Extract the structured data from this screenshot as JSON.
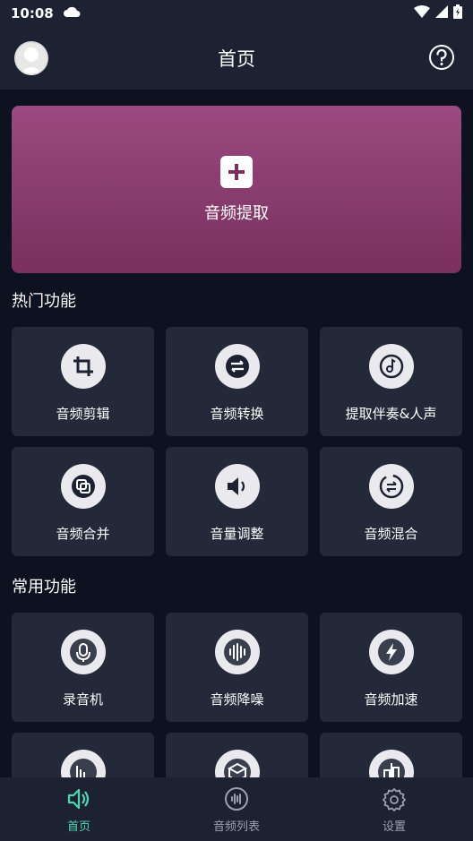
{
  "status": {
    "time": "10:08"
  },
  "header": {
    "title": "首页"
  },
  "hero": {
    "label": "音频提取"
  },
  "hot": {
    "title": "热门功能",
    "items": [
      {
        "label": "音频剪辑",
        "icon": "crop-icon"
      },
      {
        "label": "音频转换",
        "icon": "convert-icon"
      },
      {
        "label": "提取伴奏&人声",
        "icon": "music-note-icon"
      },
      {
        "label": "音频合并",
        "icon": "merge-icon"
      },
      {
        "label": "音量调整",
        "icon": "volume-icon"
      },
      {
        "label": "音频混合",
        "icon": "mix-icon"
      }
    ]
  },
  "common": {
    "title": "常用功能",
    "items": [
      {
        "label": "录音机",
        "icon": "mic-icon"
      },
      {
        "label": "音频降噪",
        "icon": "waveform-icon"
      },
      {
        "label": "音频加速",
        "icon": "lightning-icon"
      }
    ]
  },
  "nav": {
    "items": [
      {
        "label": "首页"
      },
      {
        "label": "音频列表"
      },
      {
        "label": "设置"
      }
    ]
  },
  "colors": {
    "accent": "#4fd6b0",
    "hero_top": "#9a4a80",
    "hero_bottom": "#7a2f5e",
    "card": "#232939",
    "bg": "#0d1120"
  }
}
